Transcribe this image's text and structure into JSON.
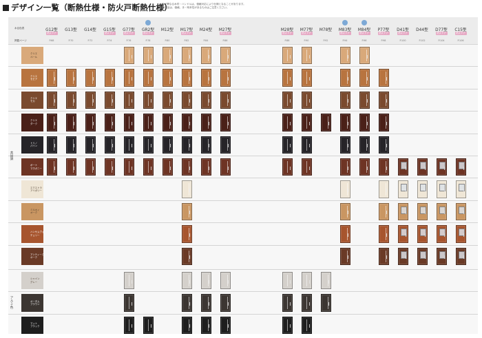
{
  "page": {
    "title": "デザイン一覧（断熱仕様・防火戸断熱仕様）",
    "note_lines": [
      "※色が異なる木材・ハンドルは、価格対応により仕様となることがあります。",
      "その製品は、価格、手・時本性があるものはご注意ください。"
    ]
  },
  "header": {
    "row_label_color": "木目色表",
    "row_label_page": "掲載ページ"
  },
  "columns": [
    {
      "name": "G12型",
      "badge": "防火ドア",
      "page": "P.68",
      "new": false
    },
    {
      "name": "G13型",
      "badge": "",
      "page": "P.70",
      "new": false
    },
    {
      "name": "G14型",
      "badge": "",
      "page": "P.72",
      "new": false
    },
    {
      "name": "G15型",
      "badge": "防火ドア",
      "page": "P.74",
      "new": false
    },
    {
      "name": "G77型",
      "badge": "防火ドア",
      "page": "P.76",
      "new": false
    },
    {
      "name": "GR2型",
      "badge": "防火ドア",
      "page": "P.78",
      "new": true
    },
    {
      "name": "M12型",
      "badge": "",
      "page": "P.80",
      "new": false
    },
    {
      "name": "M17型",
      "badge": "防火ドア",
      "page": "P.82",
      "new": false
    },
    {
      "name": "M24型",
      "badge": "",
      "page": "P.84",
      "new": false
    },
    {
      "name": "M27型",
      "badge": "防火ドア",
      "page": "P.86",
      "new": false
    },
    {
      "name": "M28型",
      "badge": "防火ドア",
      "page": "P.88",
      "new": false
    },
    {
      "name": "M77型",
      "badge": "防火ドア",
      "page": "P.90",
      "new": false
    },
    {
      "name": "M78型",
      "badge": "",
      "page": "P.92",
      "new": false
    },
    {
      "name": "M83型",
      "badge": "防火ドア",
      "page": "P.94",
      "new": true
    },
    {
      "name": "M84型",
      "badge": "防火ドア",
      "page": "P.96",
      "new": true
    },
    {
      "name": "P77型",
      "badge": "防火ドア",
      "page": "P.98",
      "new": false
    },
    {
      "name": "D41型",
      "badge": "防火ドア",
      "page": "P.100",
      "new": false
    },
    {
      "name": "D44型",
      "badge": "",
      "page": "P.102",
      "new": false
    },
    {
      "name": "D77型",
      "badge": "防火ドア",
      "page": "P.104",
      "new": false
    },
    {
      "name": "C15型",
      "badge": "防火ドア",
      "page": "P.106",
      "new": false
    }
  ],
  "groups": [
    {
      "label": "木目調",
      "rows": [
        0,
        9
      ]
    },
    {
      "label": "アルミ色",
      "rows": [
        10,
        12
      ]
    }
  ],
  "rows": [
    {
      "color": "クリエ\nペール",
      "hex": "#d9a97a",
      "door": [
        0,
        0,
        0,
        0,
        1,
        1,
        1,
        1,
        1,
        1,
        1,
        1,
        0,
        1,
        1,
        0,
        0,
        0,
        0,
        0
      ]
    },
    {
      "color": "クリエ\nセピア",
      "hex": "#b8743f",
      "door": [
        1,
        1,
        1,
        1,
        1,
        1,
        1,
        1,
        1,
        1,
        1,
        1,
        0,
        1,
        1,
        1,
        0,
        0,
        0,
        0
      ]
    },
    {
      "color": "クリエ\nモカ",
      "hex": "#7a4a2e",
      "door": [
        1,
        1,
        1,
        1,
        1,
        1,
        1,
        1,
        1,
        1,
        1,
        1,
        0,
        1,
        1,
        1,
        0,
        0,
        0,
        0
      ]
    },
    {
      "color": "クリエ\nダーク",
      "hex": "#4a2018",
      "door": [
        1,
        1,
        1,
        1,
        1,
        1,
        1,
        1,
        1,
        1,
        1,
        1,
        1,
        1,
        1,
        1,
        0,
        0,
        0,
        0
      ]
    },
    {
      "color": "トリノ\nパイン",
      "hex": "#262428",
      "door": [
        1,
        1,
        1,
        1,
        1,
        1,
        1,
        1,
        1,
        1,
        1,
        1,
        0,
        1,
        1,
        1,
        0,
        0,
        0,
        0
      ]
    },
    {
      "color": "ボート\nマホガニー",
      "hex": "#6e3424",
      "door": [
        1,
        1,
        1,
        1,
        1,
        1,
        1,
        1,
        1,
        1,
        1,
        1,
        0,
        1,
        1,
        1,
        1,
        1,
        1,
        1
      ]
    },
    {
      "color": "エクストラ\nアイボリー",
      "hex": "#efe6d6",
      "door": [
        0,
        0,
        0,
        0,
        0,
        0,
        0,
        1,
        0,
        0,
        0,
        0,
        0,
        1,
        0,
        1,
        1,
        1,
        1,
        1
      ]
    },
    {
      "color": "ミルキィ\nオーク",
      "hex": "#c99662",
      "door": [
        0,
        0,
        0,
        0,
        0,
        0,
        0,
        1,
        0,
        0,
        0,
        0,
        0,
        1,
        0,
        1,
        1,
        1,
        1,
        1
      ]
    },
    {
      "color": "ハンサムヴォ\nチェリー",
      "hex": "#a7552e",
      "door": [
        0,
        0,
        0,
        0,
        0,
        0,
        0,
        1,
        0,
        0,
        0,
        0,
        0,
        1,
        0,
        1,
        1,
        1,
        1,
        1
      ]
    },
    {
      "color": "アンティーク\nオーク",
      "hex": "#6a3a26",
      "door": [
        0,
        0,
        0,
        0,
        0,
        0,
        0,
        1,
        0,
        0,
        0,
        0,
        0,
        1,
        0,
        1,
        1,
        1,
        1,
        1
      ]
    },
    {
      "color": "シャイン\nグレー",
      "hex": "#d4d0cb",
      "door": [
        0,
        0,
        0,
        0,
        1,
        0,
        0,
        1,
        1,
        1,
        1,
        1,
        1,
        0,
        0,
        0,
        0,
        0,
        0,
        0
      ]
    },
    {
      "color": "オータム\nブラウン",
      "hex": "#3c3632",
      "door": [
        0,
        0,
        0,
        0,
        1,
        0,
        0,
        1,
        1,
        1,
        1,
        1,
        1,
        0,
        0,
        0,
        0,
        0,
        0,
        0
      ]
    },
    {
      "color": "マット\nブラック",
      "hex": "#1e1e1e",
      "door": [
        0,
        0,
        0,
        0,
        1,
        1,
        0,
        1,
        1,
        1,
        1,
        1,
        0,
        0,
        0,
        0,
        0,
        0,
        0,
        0
      ]
    }
  ]
}
